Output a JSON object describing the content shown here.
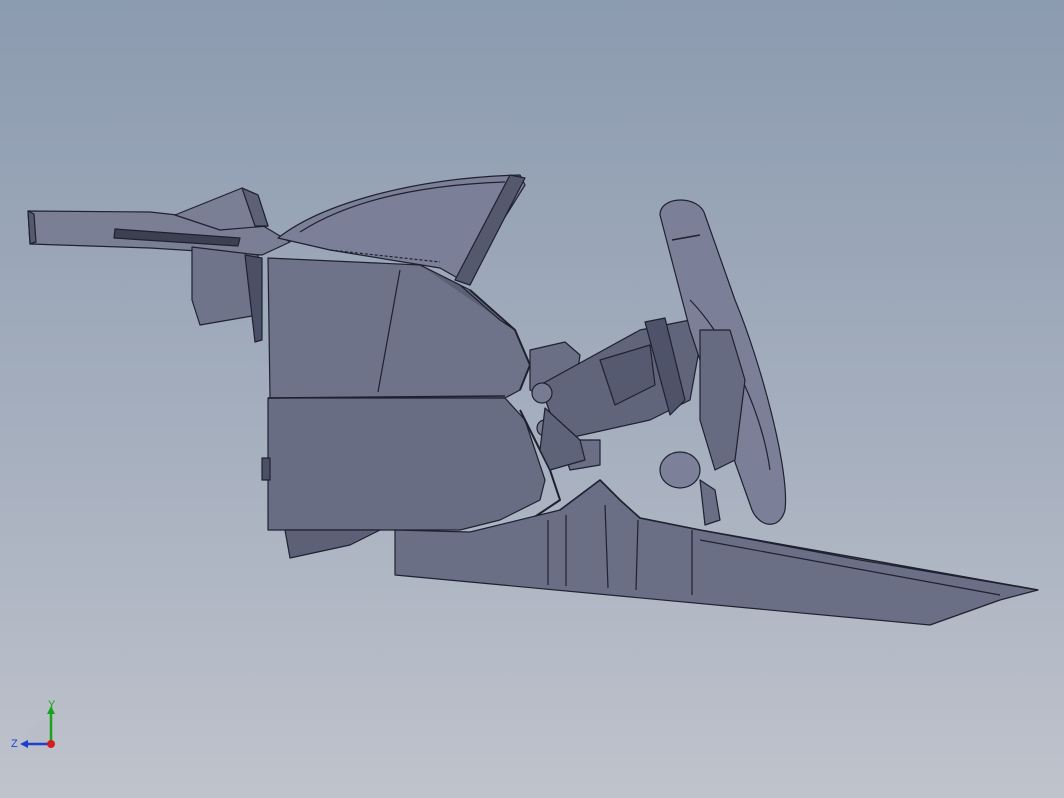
{
  "viewport": {
    "background_top": "#8c9bb0",
    "background_bottom": "#bfc3cc"
  },
  "model": {
    "body_color": "#6e7389",
    "body_light": "#8a8fa5",
    "body_dark": "#4c5066",
    "edge_color": "#1f2130"
  },
  "triad": {
    "y_label": "Y",
    "z_label": "Z",
    "y_color": "#1ba21b",
    "x_color": "#d21e1e",
    "z_color": "#1f3fd1"
  }
}
